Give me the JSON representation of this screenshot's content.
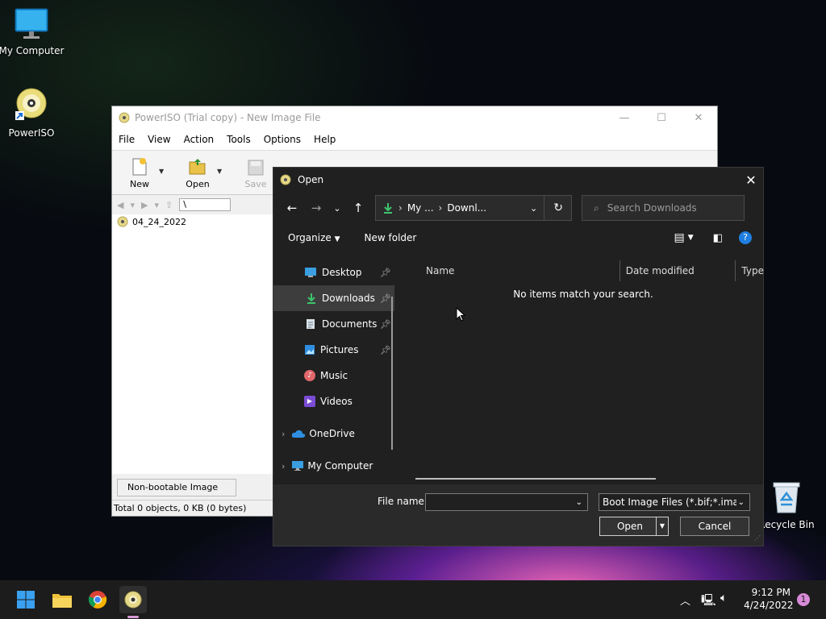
{
  "desktop": {
    "icons": [
      {
        "label": "My Computer"
      },
      {
        "label": "PowerISO"
      },
      {
        "label": "Recycle Bin"
      }
    ]
  },
  "poweriso": {
    "title": "PowerISO (Trial copy) - New Image File",
    "menu": [
      "File",
      "View",
      "Action",
      "Tools",
      "Options",
      "Help"
    ],
    "toolbar": {
      "new": "New",
      "open": "Open",
      "save": "Save"
    },
    "path": "\\",
    "tree_item": "04_24_2022",
    "status_boot": "Non-bootable Image",
    "footer": "Total 0 objects, 0 KB (0 bytes)"
  },
  "dialog": {
    "title": "Open",
    "breadcrumb": [
      "My ...",
      "Downl..."
    ],
    "search_placeholder": "Search Downloads",
    "organize": "Organize",
    "new_folder": "New folder",
    "nav": [
      {
        "label": "Desktop",
        "pinned": true
      },
      {
        "label": "Downloads",
        "pinned": true,
        "selected": true
      },
      {
        "label": "Documents",
        "pinned": true
      },
      {
        "label": "Pictures",
        "pinned": true
      },
      {
        "label": "Music",
        "pinned": false
      },
      {
        "label": "Videos",
        "pinned": false
      },
      {
        "label": "OneDrive",
        "pinned": false
      },
      {
        "label": "My Computer",
        "pinned": false
      }
    ],
    "columns": {
      "name": "Name",
      "date": "Date modified",
      "type": "Type"
    },
    "empty_message": "No items match your search.",
    "file_name_label": "File name:",
    "file_name_value": "",
    "file_type": "Boot Image Files (*.bif;*.ima;*.ir",
    "open_button": "Open",
    "cancel_button": "Cancel"
  },
  "taskbar": {
    "time": "9:12 PM",
    "date": "4/24/2022",
    "notification_count": "1"
  }
}
